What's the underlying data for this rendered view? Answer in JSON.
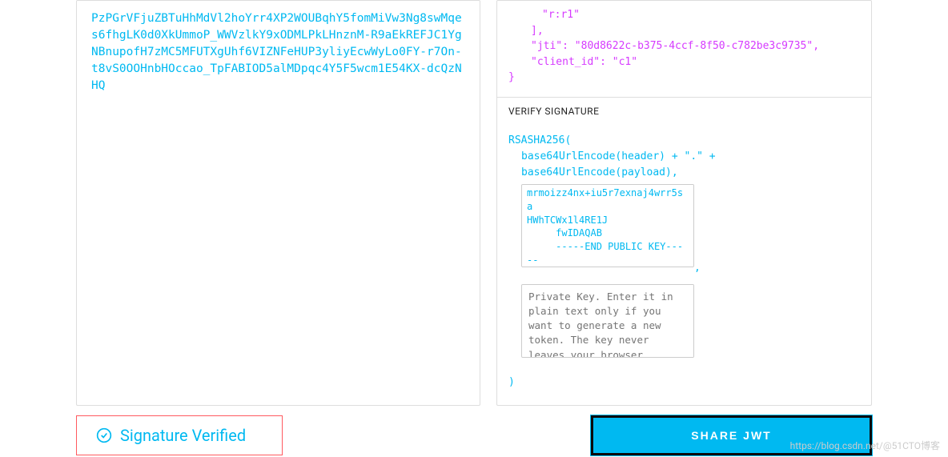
{
  "encoded": {
    "fragment": "PzPGrVFjuZBTuHhMdVl2hoYrr4XP2WOUBqhY5fomMiVw3Ng8swMqes6fhgLK0d0XkUmmoP_WWVzlkY9xODMLPkLHnznM-R9aEkREFJC1YgNBnupofH7zMC5MFUTXgUhf6VIZNFeHUP3yliyEcwWyLo0FY-r7On-t8vS0OOHnbHOccao_TpFABIOD5alMDpqc4Y5F5wcm1E54KX-dcQzNHQ"
  },
  "payload": {
    "role_value": "\"r:r1\"",
    "jti_label": "\"jti\"",
    "jti_value": "\"80d8622c-b375-4ccf-8f50-c782be3c9735\"",
    "client_id_label": "\"client_id\"",
    "client_id_value": "\"c1\"",
    "close_bracket": "]",
    "close_brace": "}"
  },
  "verify": {
    "header_label": "VERIFY SIGNATURE",
    "algo_open": "RSASHA256(",
    "line_header": "base64UrlEncode(header) + \".\" +",
    "line_payload": "base64UrlEncode(payload),",
    "pubkey_content": "mrmoizz4nx+iu5r7exnaj4wrr5sa\nHWhTCWx1l4RE1J\n     fwIDAQAB\n     -----END PUBLIC KEY-----",
    "privkey_placeholder": "Private Key. Enter it in plain text only if you want to generate a new token. The key never leaves your browser.",
    "close_paren": ")"
  },
  "status": {
    "label": "Signature Verified"
  },
  "share": {
    "label": "SHARE JWT"
  },
  "watermark": "https://blog.csdn.net/@51CTO博客"
}
